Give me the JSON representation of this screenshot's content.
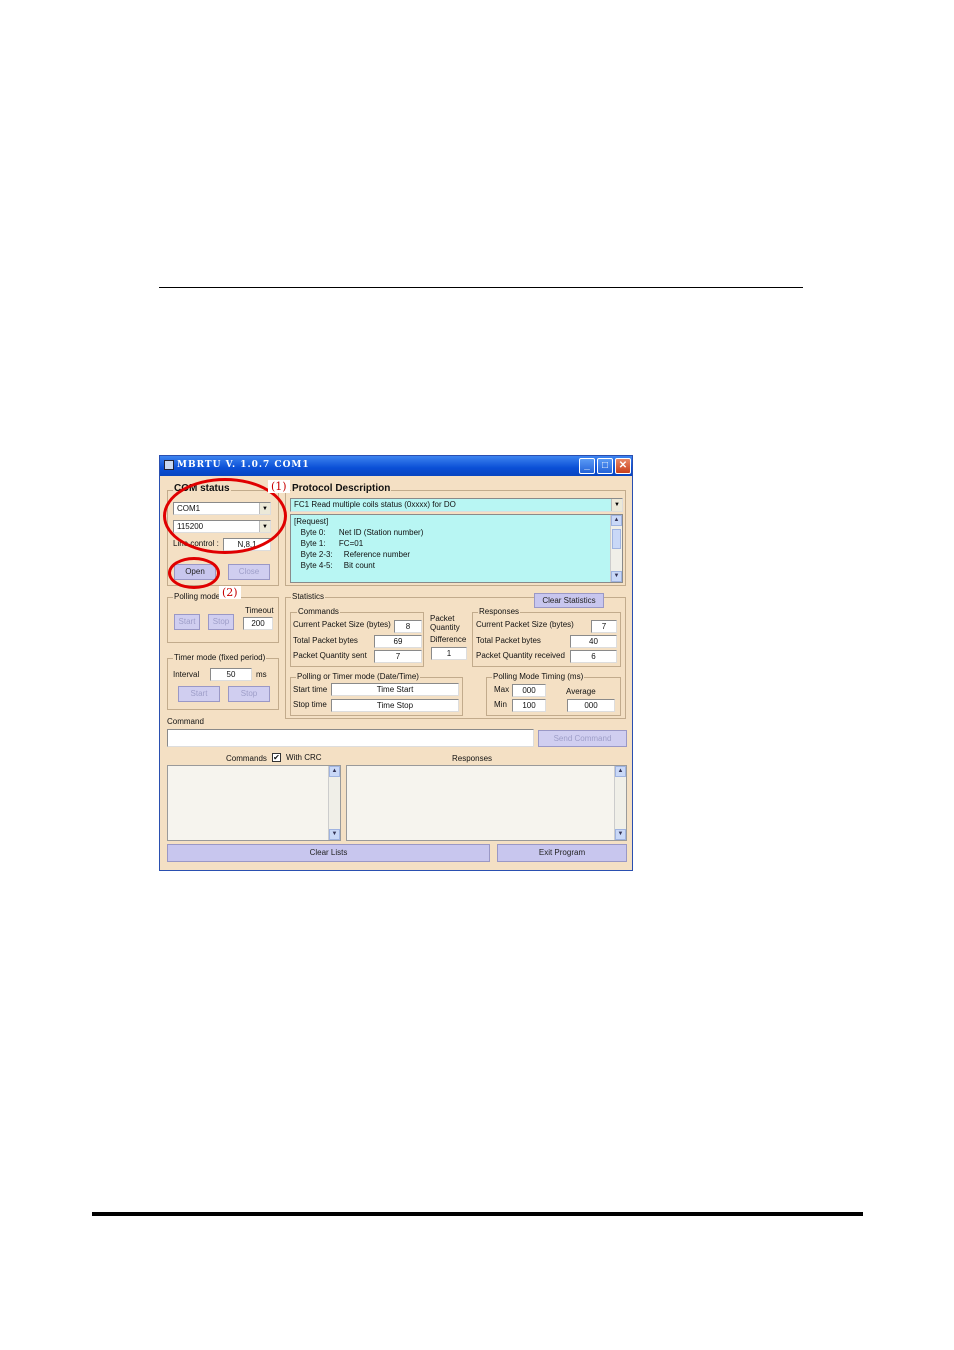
{
  "window": {
    "title": "MBRTU  V. 1.0.7  COM1",
    "minimize": "_",
    "maximize": "□",
    "close": "✕"
  },
  "com_status": {
    "label": "COM status",
    "port": "COM1",
    "baud": "115200",
    "line_control_label": "Line control :",
    "line_control_value": "N,8,1",
    "open": "Open",
    "close": "Close"
  },
  "protocol": {
    "label": "Protocol Description",
    "function": "FC1  Read multiple coils status (0xxxx)  for DO",
    "lines": [
      "[Request]",
      "   Byte 0:      Net ID (Station number)",
      "   Byte 1:      FC=01",
      "   Byte 2-3:     Reference number",
      "   Byte 4-5:     Bit count"
    ]
  },
  "polling_mode": {
    "label": "Polling mode",
    "timeout_label": "Timeout",
    "timeout": "200",
    "start": "Start",
    "stop": "Stop"
  },
  "timer_mode": {
    "label": "Timer mode (fixed period)",
    "interval_label": "Interval",
    "interval": "50",
    "unit": "ms",
    "start": "Start",
    "stop": "Stop"
  },
  "statistics": {
    "label": "Statistics",
    "clear": "Clear Statistics",
    "commands": {
      "label": "Commands",
      "current_label": "Current Packet Size (bytes)",
      "current": "8",
      "total_label": "Total Packet bytes",
      "total": "69",
      "quantity_label": "Packet Quantity sent",
      "quantity": "7"
    },
    "packet_quantity": {
      "label1": "Packet",
      "label2": "Quantity",
      "label3": "Difference",
      "value": "1"
    },
    "responses": {
      "label": "Responses",
      "current_label": "Current Packet Size (bytes)",
      "current": "7",
      "total_label": "Total Packet bytes",
      "total": "40",
      "quantity_label": "Packet Quantity received",
      "quantity": "6"
    },
    "polling_time": {
      "label": "Polling  or Timer mode  (Date/Time)",
      "start_label": "Start time",
      "start_value": "Time Start",
      "stop_label": "Stop time",
      "stop_value": "Time Stop"
    },
    "timing": {
      "label": "Polling Mode Timing (ms)",
      "max_label": "Max",
      "max": "000",
      "min_label": "Min",
      "min": "100",
      "avg_label": "Average",
      "avg": "000"
    }
  },
  "command": {
    "label": "Command",
    "value": "",
    "send": "Send Command"
  },
  "lists": {
    "commands_label": "Commands",
    "with_crc_label": "With CRC",
    "with_crc_checked": "✔",
    "responses_label": "Responses"
  },
  "footer": {
    "clear_lists": "Clear Lists",
    "exit": "Exit Program"
  },
  "annotations": {
    "one": "(1)",
    "two": "(2)",
    "color": "#e00000"
  }
}
